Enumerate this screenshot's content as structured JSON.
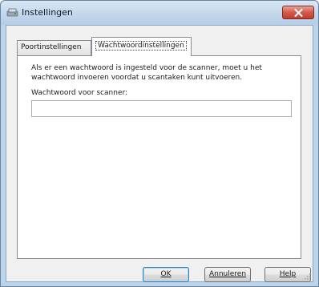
{
  "window": {
    "title": "Instellingen",
    "close_icon": "close-icon",
    "app_icon": "scanner-settings-icon"
  },
  "tabs": [
    {
      "label": "Poortinstellingen",
      "selected": false
    },
    {
      "label": "Wachtwoordinstellingen",
      "selected": true
    }
  ],
  "password_tab": {
    "description": "Als er een wachtwoord is ingesteld voor de scanner, moet u het wachtwoord invoeren voordat u scantaken kunt uitvoeren.",
    "field_label": "Wachtwoord voor scanner:",
    "field_value": ""
  },
  "buttons": {
    "ok": {
      "label": "OK",
      "accelerator": "O"
    },
    "cancel": {
      "label": "Annuleren",
      "accelerator": "A"
    },
    "help": {
      "label": "Help",
      "accelerator": "H"
    }
  },
  "colors": {
    "titlebar": "#c3d7ec",
    "close_button": "#d3594a",
    "dialog_background": "#f0f0f0",
    "default_button_border": "#3c7fb1"
  }
}
